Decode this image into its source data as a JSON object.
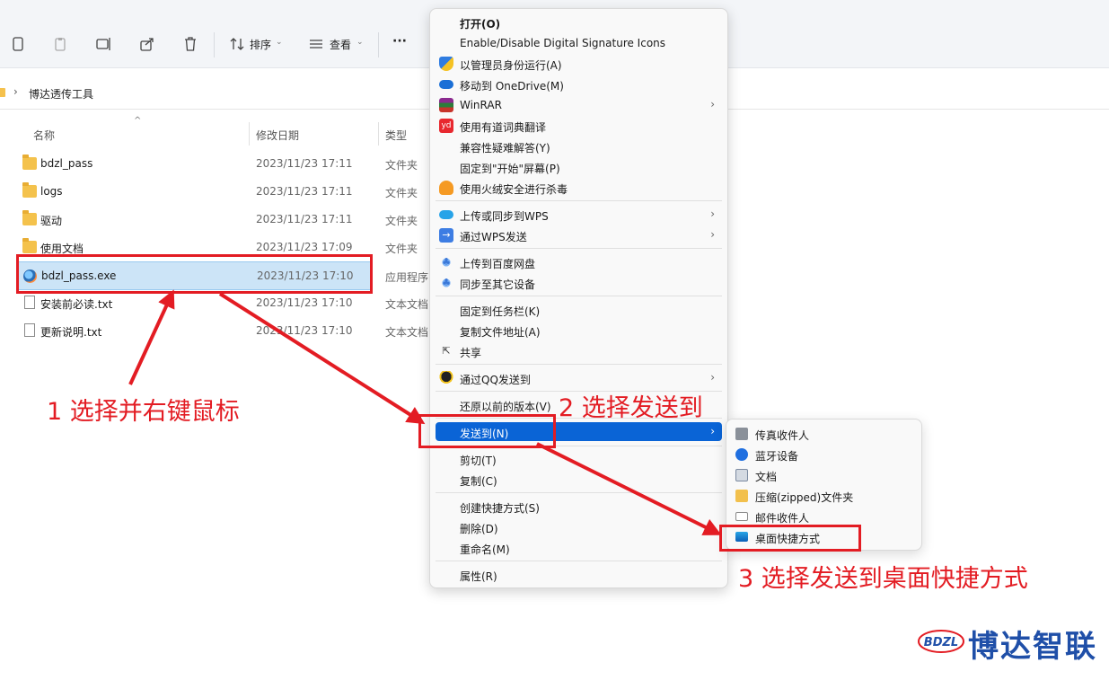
{
  "toolbar": {
    "sort_label": "排序",
    "view_label": "查看",
    "more_label": "···"
  },
  "breadcrumb": {
    "separator": "›",
    "current": "博达透传工具"
  },
  "columns": {
    "name": "名称",
    "date": "修改日期",
    "type": "类型"
  },
  "files": [
    {
      "name": "bdzl_pass",
      "date": "2023/11/23 17:11",
      "type": "文件夹",
      "icon": "folder-icon"
    },
    {
      "name": "logs",
      "date": "2023/11/23 17:11",
      "type": "文件夹",
      "icon": "folder-icon"
    },
    {
      "name": "驱动",
      "date": "2023/11/23 17:11",
      "type": "文件夹",
      "icon": "folder-icon"
    },
    {
      "name": "使用文档",
      "date": "2023/11/23 17:09",
      "type": "文件夹",
      "icon": "folder-icon"
    },
    {
      "name": "bdzl_pass.exe",
      "date": "2023/11/23 17:10",
      "type": "应用程序",
      "icon": "app-icon"
    },
    {
      "name": "安装前必读.txt",
      "date": "2023/11/23 17:10",
      "type": "文本文档",
      "icon": "text-file-icon"
    },
    {
      "name": "更新说明.txt",
      "date": "2023/11/23 17:10",
      "type": "文本文档",
      "icon": "text-file-icon"
    }
  ],
  "context_menu": {
    "items": [
      {
        "label": "打开(O)"
      },
      {
        "label": "Enable/Disable Digital Signature Icons"
      },
      {
        "label": "以管理员身份运行(A)"
      },
      {
        "label": "移动到 OneDrive(M)"
      },
      {
        "label": "WinRAR"
      },
      {
        "label": "使用有道词典翻译"
      },
      {
        "label": "兼容性疑难解答(Y)"
      },
      {
        "label": "固定到\"开始\"屏幕(P)"
      },
      {
        "label": "使用火绒安全进行杀毒"
      },
      {
        "label": "上传或同步到WPS"
      },
      {
        "label": "通过WPS发送"
      },
      {
        "label": "上传到百度网盘"
      },
      {
        "label": "同步至其它设备"
      },
      {
        "label": "固定到任务栏(K)"
      },
      {
        "label": "复制文件地址(A)"
      },
      {
        "label": "共享"
      },
      {
        "label": "通过QQ发送到"
      },
      {
        "label": "还原以前的版本(V)"
      },
      {
        "label": "发送到(N)"
      },
      {
        "label": "剪切(T)"
      },
      {
        "label": "复制(C)"
      },
      {
        "label": "创建快捷方式(S)"
      },
      {
        "label": "删除(D)"
      },
      {
        "label": "重命名(M)"
      },
      {
        "label": "属性(R)"
      }
    ]
  },
  "send_to_menu": {
    "items": [
      {
        "label": "传真收件人"
      },
      {
        "label": "蓝牙设备"
      },
      {
        "label": "文档"
      },
      {
        "label": "压缩(zipped)文件夹"
      },
      {
        "label": "邮件收件人"
      },
      {
        "label": "桌面快捷方式"
      }
    ]
  },
  "annotations": {
    "step1": "1 选择并右键鼠标",
    "step2": "2 选择发送到",
    "step3": "3 选择发送到桌面快捷方式"
  },
  "logo": {
    "badge": "BDZL",
    "name": "博达智联"
  },
  "colors": {
    "accent_red": "#e31c23",
    "menu_highlight": "#0a64d6",
    "logo_blue": "#1f4fa8"
  }
}
